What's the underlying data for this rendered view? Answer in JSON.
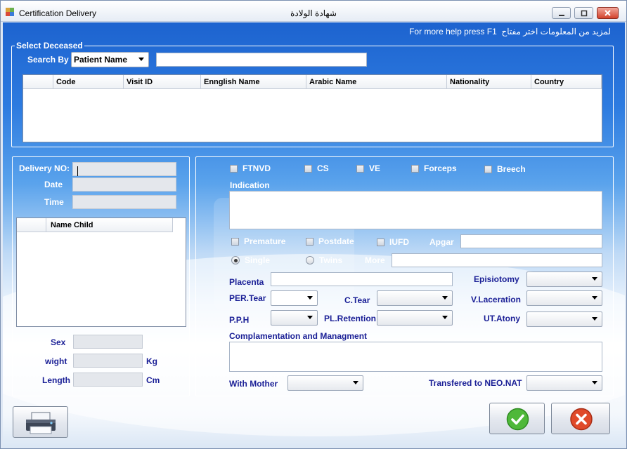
{
  "window": {
    "title_left": "Certification  Delivery",
    "title_center": "شهادة الولادة"
  },
  "help": {
    "text": "For more help press F1",
    "arabic": "لمزيد من المعلومات اختر مفتاح"
  },
  "select_deceased": {
    "legend": "Select Deceased",
    "search_by_label": "Search By",
    "search_by_value": "Patient Name",
    "search_value": "",
    "columns": [
      "Code",
      "Visit ID",
      "Ennglish Name",
      "Arabic Name",
      "Nationality",
      "Country"
    ]
  },
  "delivery": {
    "delivery_no_label": "Delivery NO:",
    "date_label": "Date",
    "time_label": "Time",
    "child_column": "Name Child",
    "sex_label": "Sex",
    "weight_label": "wight",
    "weight_unit": "Kg",
    "length_label": "Length",
    "length_unit": "Cm"
  },
  "options": {
    "ftnvd": "FTNVD",
    "cs": "CS",
    "ve": "VE",
    "forceps": "Forceps",
    "breech": "Breech",
    "indication": "Indication",
    "premature": "Premature",
    "postdate": "Postdate",
    "iufd": "IUFD",
    "apgar": "Apgar",
    "single": "Single",
    "twins": "Twins",
    "more": "More",
    "placenta": "Placenta",
    "episiotomy": "Episiotomy",
    "per_tear": "PER.Tear",
    "c_tear": "C.Tear",
    "v_laceration": "V.Laceration",
    "pph": "P.P.H",
    "pl_retention": "PL.Retention",
    "ut_atony": "UT.Atony",
    "complamentation": "Complamentation and Managment",
    "with_mother": "With Mother",
    "transfered": "Transfered to NEO.NAT"
  },
  "colors": {
    "label_blue": "#1a1f96",
    "header_blue": "#1d63cf"
  },
  "icons": {
    "print": "printer-icon",
    "ok": "check-icon",
    "cancel": "x-icon"
  }
}
